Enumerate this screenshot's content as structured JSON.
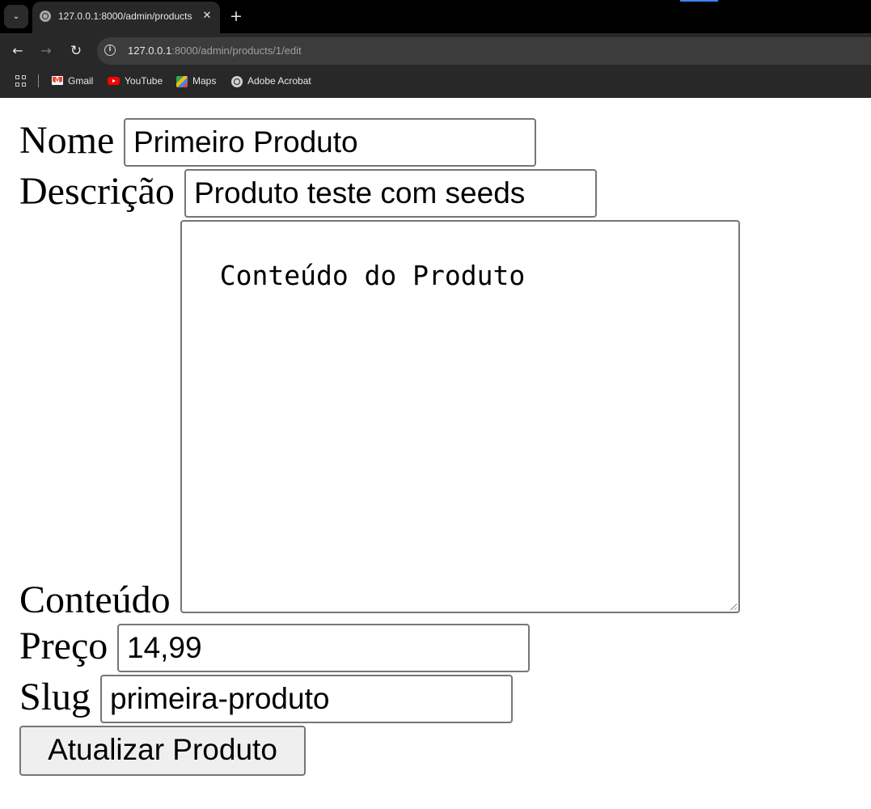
{
  "browser": {
    "tab_title": "127.0.0.1:8000/admin/products/1/edit",
    "tab_menu_glyph": "⌄",
    "close_glyph": "✕",
    "new_tab_glyph": "+",
    "nav": {
      "back_glyph": "←",
      "forward_glyph": "→",
      "reload_glyph": "↻"
    },
    "address_host": "127.0.0.1",
    "address_path": ":8000/admin/products/1/edit",
    "bookmarks": [
      {
        "label": "Gmail",
        "icon": "gmail-icon"
      },
      {
        "label": "YouTube",
        "icon": "youtube-icon"
      },
      {
        "label": "Maps",
        "icon": "maps-icon"
      },
      {
        "label": "Adobe Acrobat",
        "icon": "globe-icon"
      }
    ]
  },
  "form": {
    "nome_label": "Nome",
    "nome_value": "Primeiro Produto",
    "descricao_label": "Descrição",
    "descricao_value": "Produto teste com seeds",
    "conteudo_label": "Conteúdo",
    "conteudo_value": "Conteúdo do Produto",
    "preco_label": "Preço",
    "preco_value": "14,99",
    "slug_label": "Slug",
    "slug_value": "primeira-produto",
    "submit_label": "Atualizar Produto"
  },
  "colors": {
    "tabstrip": "#000000",
    "chrome": "#282828",
    "omnibox": "#3c3c3c",
    "input_border": "#767676",
    "button_bg": "#efefef"
  }
}
